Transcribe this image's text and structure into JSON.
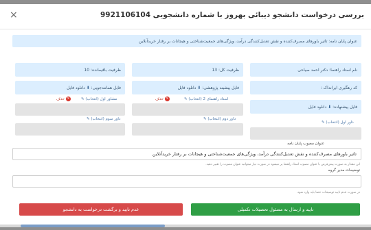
{
  "modal": {
    "title": "بررسی درخواست دانشجو دیبائی بهروز با شماره دانشجویی 9921106104",
    "close_icon": "×"
  },
  "thesis_banner": "عنوان پایان نامه: تاثیر باورهای مصرف‌کننده و نقش تعدیل‌کنندگی درآمد، ویژگی‌های جمعیت‌شناختی و هیجانات بر رفتار خریدآنلاین",
  "fields": {
    "supervisor": "نام استاد راهنما: دکتر احمد صیاحی",
    "total_capacity": "ظرفیت کل: 13",
    "remaining_capacity": "ظرفیت باقیمانده: 10",
    "tracking_code": "کد رهگیری ایرانداک :",
    "research_file": "فایل پیشینه پژوهشی:",
    "similarity_file": "فایل همانندجویی:",
    "proposal_file": "فایل پیشنهاده:",
    "download": "دانلود فایل"
  },
  "links": {
    "advisor_1": "مشاور اول (انتخاب)",
    "advisor_2_supervisor": "استاد راهنمای 2 (انتخاب)",
    "judge_1": "داور اول (انتخاب)",
    "judge_2": "داور دوم (انتخاب)",
    "judge_3": "داور سوم (انتخاب)",
    "delete": "حذف"
  },
  "approved_title": {
    "label": "عنوان مصوب پایان نامه",
    "value": "تاثیر باورهای مصرف‌کننده و نقش تعدیل‌کنندگی درآمد، ویژگی‌های جمعیت‌شناختی و هیجانات بر رفتار خریدآنلاین",
    "note": "این مقدار به صورت پیش‌فرض با عنوان مصوب استاد راهنما پر میشود در صورت نیاز میتوانید عنوان مصوب را تغییر دهید."
  },
  "group_manager_notes": {
    "label": "توضیحات مدیر گروه",
    "value": "",
    "note": "در صورت عدم تایید توضیحات حتما باید وارد شود."
  },
  "buttons": {
    "approve": "تایید و ارسال به مسئول تحصیلات تکمیلی",
    "reject": "عدم تایید و برگشت درخواست به دانشجو"
  },
  "colors": {
    "accent_blue": "#dceefe",
    "approve_green": "#2f9e45",
    "reject_red": "#d74a4a",
    "link_blue": "#4a76a8"
  }
}
